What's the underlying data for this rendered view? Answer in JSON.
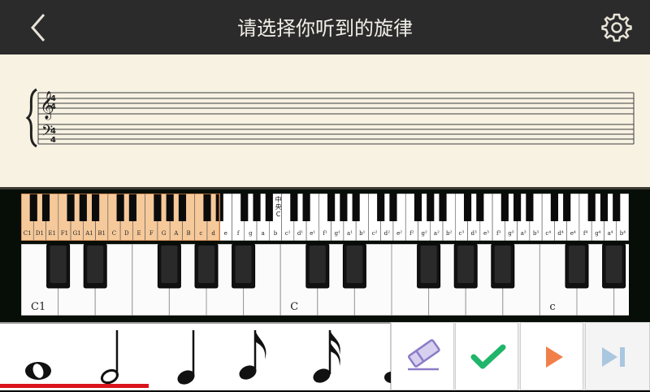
{
  "header": {
    "title": "请选择你听到的旋律",
    "back_icon": "chevron-left-icon",
    "settings_icon": "gear-icon"
  },
  "staff": {
    "time_signature_top": "4",
    "time_signature_bottom": "4"
  },
  "keyboard": {
    "mini_white_labels": [
      "C1",
      "D1",
      "E1",
      "F1",
      "G1",
      "A1",
      "B1",
      "C",
      "D",
      "E",
      "F",
      "G",
      "A",
      "B",
      "c",
      "d",
      "e",
      "f",
      "g",
      "a",
      "b",
      "c¹",
      "d¹",
      "e¹",
      "f¹",
      "g¹",
      "a¹",
      "b¹",
      "c²",
      "d²",
      "e²",
      "f²",
      "g²",
      "a²",
      "b²",
      "c³",
      "d³",
      "e³",
      "f³",
      "g³",
      "a³",
      "b³",
      "c⁴",
      "d⁴",
      "e⁴",
      "f⁴",
      "g⁴",
      "a⁴",
      "b⁴"
    ],
    "range_marker": "中央C",
    "big_labels": [
      "C1",
      "C",
      "c"
    ]
  },
  "note_palette": {
    "items": [
      "whole-note-icon",
      "half-note-icon",
      "quarter-note-icon",
      "eighth-note-icon",
      "sixteenth-note-icon"
    ],
    "progress_fraction": 0.38
  },
  "toolbar": {
    "tools": [
      "eraser-icon",
      "checkmark-icon",
      "play-icon",
      "skip-forward-icon"
    ]
  },
  "colors": {
    "header_bg": "#2b2b2b",
    "staff_bg": "#f8f2e3",
    "highlight_keys": "#f6c99a",
    "progress": "#d9141b",
    "check": "#1fb56a",
    "play": "#f07f4a",
    "eraser": "#8b7cc8"
  }
}
